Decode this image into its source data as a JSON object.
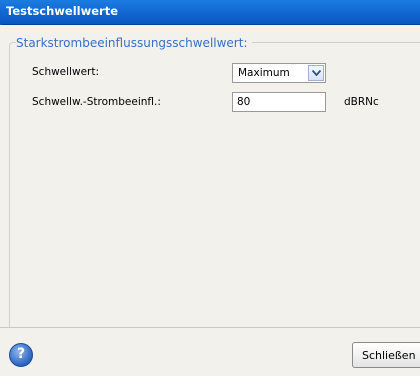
{
  "window": {
    "title": "Testschwellwerte"
  },
  "group": {
    "legend": "Starkstrombeeinflussungsschwellwert:"
  },
  "threshold": {
    "label": "Schwellwert:",
    "selected": "Maximum"
  },
  "interference": {
    "label": "Schwellw.-Strombeeinfl.:",
    "value": "80",
    "unit": "dBRNc"
  },
  "footer": {
    "help_icon": "help-icon",
    "close_label": "Schließen"
  },
  "colors": {
    "titlebar": "#0a55c2",
    "legend": "#3a6fc4",
    "panel": "#f3f1ec"
  }
}
